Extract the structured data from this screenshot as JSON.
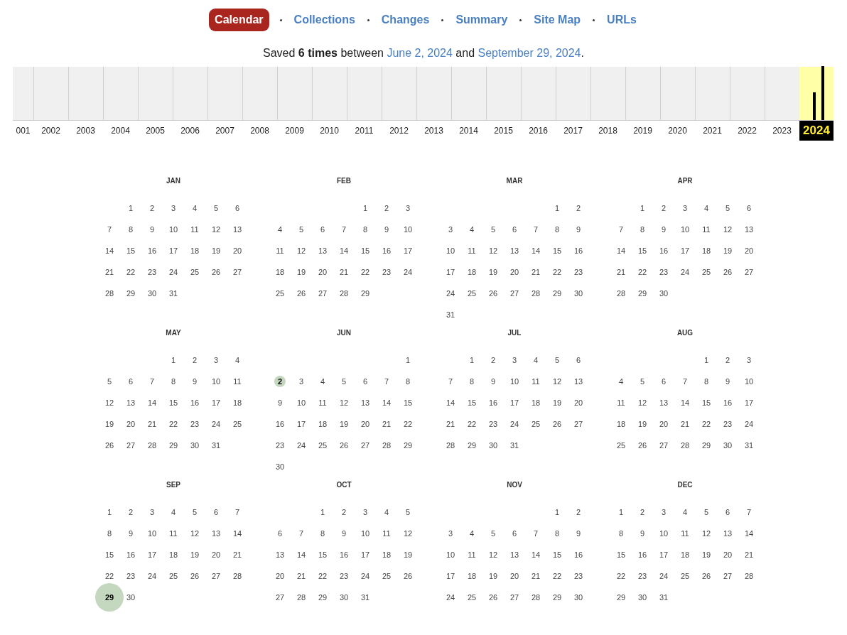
{
  "nav": [
    {
      "label": "Calendar",
      "selected": true
    },
    {
      "label": "Collections",
      "selected": false
    },
    {
      "label": "Changes",
      "selected": false
    },
    {
      "label": "Summary",
      "selected": false
    },
    {
      "label": "Site Map",
      "selected": false
    },
    {
      "label": "URLs",
      "selected": false
    }
  ],
  "summary": {
    "prefix": "Saved **6 times** between",
    "first_link": "June 2, 2024",
    "middle": "and",
    "last_link": "September 29, 2024",
    "suffix": "."
  },
  "timeline": {
    "years": [
      {
        "label": "001",
        "selected": false
      },
      {
        "label": "2002",
        "selected": false
      },
      {
        "label": "2003",
        "selected": false
      },
      {
        "label": "2004",
        "selected": false
      },
      {
        "label": "2005",
        "selected": false
      },
      {
        "label": "2006",
        "selected": false
      },
      {
        "label": "2007",
        "selected": false
      },
      {
        "label": "2008",
        "selected": false
      },
      {
        "label": "2009",
        "selected": false
      },
      {
        "label": "2010",
        "selected": false
      },
      {
        "label": "2011",
        "selected": false
      },
      {
        "label": "2012",
        "selected": false
      },
      {
        "label": "2013",
        "selected": false
      },
      {
        "label": "2014",
        "selected": false
      },
      {
        "label": "2015",
        "selected": false
      },
      {
        "label": "2016",
        "selected": false
      },
      {
        "label": "2017",
        "selected": false
      },
      {
        "label": "2018",
        "selected": false
      },
      {
        "label": "2019",
        "selected": false
      },
      {
        "label": "2020",
        "selected": false
      },
      {
        "label": "2021",
        "selected": false
      },
      {
        "label": "2022",
        "selected": false
      },
      {
        "label": "2023",
        "selected": false
      },
      {
        "label": "2024",
        "selected": true
      }
    ]
  },
  "months": [
    {
      "name": "JAN",
      "weeks": [
        [
          "1",
          "2",
          "3",
          "4",
          "5",
          "6"
        ],
        [
          "7",
          "8",
          "9",
          "10",
          "11",
          "12",
          "13"
        ],
        [
          "14",
          "15",
          "16",
          "17",
          "18",
          "19",
          "20"
        ],
        [
          "21",
          "22",
          "23",
          "24",
          "25",
          "26",
          "27"
        ],
        [
          "28",
          "29",
          "30",
          "31"
        ]
      ]
    },
    {
      "name": "FEB",
      "weeks": [
        [
          "1",
          "2",
          "3"
        ],
        [
          "4",
          "5",
          "6",
          "7",
          "8",
          "9",
          "10"
        ],
        [
          "11",
          "12",
          "13",
          "14",
          "15",
          "16",
          "17"
        ],
        [
          "18",
          "19",
          "20",
          "21",
          "22",
          "23",
          "24"
        ],
        [
          "25",
          "26",
          "27",
          "28",
          "29"
        ]
      ]
    },
    {
      "name": "MAR",
      "weeks": [
        [
          "1",
          "2"
        ],
        [
          "3",
          "4",
          "5",
          "6",
          "7",
          "8",
          "9"
        ],
        [
          "10",
          "11",
          "12",
          "13",
          "14",
          "15",
          "16"
        ],
        [
          "17",
          "18",
          "19",
          "20",
          "21",
          "22",
          "23"
        ],
        [
          "24",
          "25",
          "26",
          "27",
          "28",
          "29",
          "30"
        ],
        [
          "31"
        ]
      ]
    },
    {
      "name": "APR",
      "weeks": [
        [
          "1",
          "2",
          "3",
          "4",
          "5",
          "6"
        ],
        [
          "7",
          "8",
          "9",
          "10",
          "11",
          "12",
          "13"
        ],
        [
          "14",
          "15",
          "16",
          "17",
          "18",
          "19",
          "20"
        ],
        [
          "21",
          "22",
          "23",
          "24",
          "25",
          "26",
          "27"
        ],
        [
          "28",
          "29",
          "30"
        ]
      ]
    },
    {
      "name": "MAY",
      "weeks": [
        [
          "1",
          "2",
          "3",
          "4"
        ],
        [
          "5",
          "6",
          "7",
          "8",
          "9",
          "10",
          "11"
        ],
        [
          "12",
          "13",
          "14",
          "15",
          "16",
          "17",
          "18"
        ],
        [
          "19",
          "20",
          "21",
          "22",
          "23",
          "24",
          "25"
        ],
        [
          "26",
          "27",
          "28",
          "29",
          "30",
          "31"
        ]
      ]
    },
    {
      "name": "JUN",
      "weeks": [
        [
          "1"
        ],
        [
          {
            "label": "2",
            "kind": "small"
          },
          "3",
          "4",
          "5",
          "6",
          "7",
          "8"
        ],
        [
          "9",
          "10",
          "11",
          "12",
          "13",
          "14",
          "15"
        ],
        [
          "16",
          "17",
          "18",
          "19",
          "20",
          "21",
          "22"
        ],
        [
          "23",
          "24",
          "25",
          "26",
          "27",
          "28",
          "29"
        ],
        [
          "30"
        ]
      ]
    },
    {
      "name": "JUL",
      "weeks": [
        [
          "1",
          "2",
          "3",
          "4",
          "5",
          "6"
        ],
        [
          "7",
          "8",
          "9",
          "10",
          "11",
          "12",
          "13"
        ],
        [
          "14",
          "15",
          "16",
          "17",
          "18",
          "19",
          "20"
        ],
        [
          "21",
          "22",
          "23",
          "24",
          "25",
          "26",
          "27"
        ],
        [
          "28",
          "29",
          "30",
          "31"
        ]
      ]
    },
    {
      "name": "AUG",
      "weeks": [
        [
          "1",
          "2",
          "3"
        ],
        [
          "4",
          "5",
          "6",
          "7",
          "8",
          "9",
          "10"
        ],
        [
          "11",
          "12",
          "13",
          "14",
          "15",
          "16",
          "17"
        ],
        [
          "18",
          "19",
          "20",
          "21",
          "22",
          "23",
          "24"
        ],
        [
          "25",
          "26",
          "27",
          "28",
          "29",
          "30",
          "31"
        ]
      ]
    },
    {
      "name": "SEP",
      "weeks": [
        [
          "1",
          "2",
          "3",
          "4",
          "5",
          "6",
          "7"
        ],
        [
          "8",
          "9",
          "10",
          "11",
          "12",
          "13",
          "14"
        ],
        [
          "15",
          "16",
          "17",
          "18",
          "19",
          "20",
          "21"
        ],
        [
          "22",
          "23",
          "24",
          "25",
          "26",
          "27",
          "28"
        ],
        [
          {
            "label": "29",
            "kind": "large"
          },
          "30"
        ]
      ]
    },
    {
      "name": "OCT",
      "weeks": [
        [
          "1",
          "2",
          "3",
          "4",
          "5"
        ],
        [
          "6",
          "7",
          "8",
          "9",
          "10",
          "11",
          "12"
        ],
        [
          "13",
          "14",
          "15",
          "16",
          "17",
          "18",
          "19"
        ],
        [
          "20",
          "21",
          "22",
          "23",
          "24",
          "25",
          "26"
        ],
        [
          "27",
          "28",
          "29",
          "30",
          "31"
        ]
      ]
    },
    {
      "name": "NOV",
      "weeks": [
        [
          "1",
          "2"
        ],
        [
          "3",
          "4",
          "5",
          "6",
          "7",
          "8",
          "9"
        ],
        [
          "10",
          "11",
          "12",
          "13",
          "14",
          "15",
          "16"
        ],
        [
          "17",
          "18",
          "19",
          "20",
          "21",
          "22",
          "23"
        ],
        [
          "24",
          "25",
          "26",
          "27",
          "28",
          "29",
          "30"
        ]
      ]
    },
    {
      "name": "DEC",
      "weeks": [
        [
          "1",
          "2",
          "3",
          "4",
          "5",
          "6",
          "7"
        ],
        [
          "8",
          "9",
          "10",
          "11",
          "12",
          "13",
          "14"
        ],
        [
          "15",
          "16",
          "17",
          "18",
          "19",
          "20",
          "21"
        ],
        [
          "22",
          "23",
          "24",
          "25",
          "26",
          "27",
          "28"
        ],
        [
          "29",
          "30",
          "31"
        ]
      ]
    }
  ]
}
